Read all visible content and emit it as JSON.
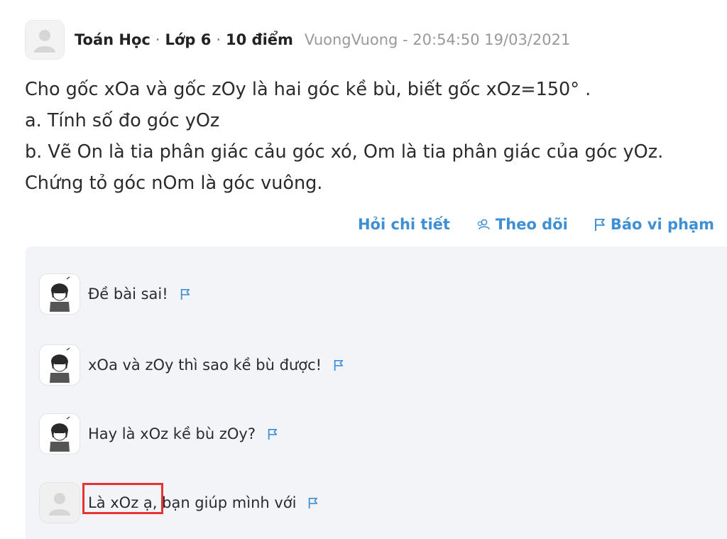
{
  "question": {
    "subject": "Toán Học",
    "grade": "Lớp 6",
    "points": "10 điểm",
    "author": "VuongVuong - 20:54:50 19/03/2021",
    "lines": [
      "Cho gốc xOa và gốc zOy là hai góc kề bù, biết gốc xOz=150° .",
      "a. Tính số đo góc yOz",
      "b. Vẽ On là tia phân giác cảu góc xó, Om là tia phân giác của góc yOz.",
      "Chứng tỏ góc nOm là góc vuông."
    ]
  },
  "actions": {
    "ask_detail": "Hỏi chi tiết",
    "follow": "Theo dõi",
    "report": "Báo vi phạm"
  },
  "comments": [
    {
      "text": "Đề bài sai!",
      "avatar": "anime-avatar"
    },
    {
      "text": "xOa và zOy thì sao kề bù được!",
      "avatar": "anime-avatar"
    },
    {
      "text": "Hay là xOz kề bù zOy?",
      "avatar": "anime-avatar"
    },
    {
      "text": "Là xOz ạ, bạn giúp mình với",
      "avatar": "default-avatar"
    }
  ],
  "colors": {
    "accent": "#3f8fd4",
    "comment_bg": "#f2f4f8",
    "highlight": "#e53232"
  }
}
